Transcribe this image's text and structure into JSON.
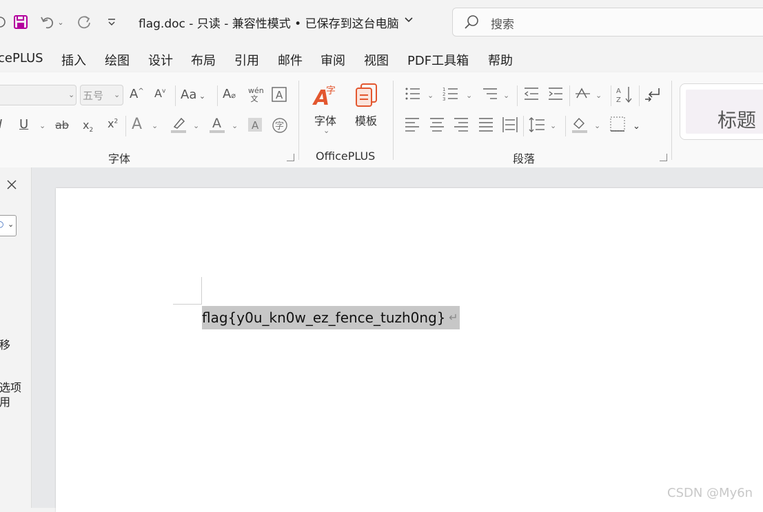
{
  "titlebar": {
    "document_title": "flag.doc  -  只读  -  兼容性模式 • 已保存到这台电脑"
  },
  "search": {
    "placeholder": "搜索"
  },
  "menu": {
    "items": [
      "cePLUS",
      "插入",
      "绘图",
      "设计",
      "布局",
      "引用",
      "邮件",
      "审阅",
      "视图",
      "PDF工具箱",
      "帮助"
    ]
  },
  "ribbon": {
    "font_size_value": "五号",
    "case_label": "Aa",
    "font_group_label": "字体",
    "officeplus": {
      "font_button": "字体",
      "template_button": "模板",
      "group_label": "OfficePLUS"
    },
    "paragraph_group_label": "段落",
    "style_heading": "标题"
  },
  "sidepane": {
    "text_move": "移",
    "text_options1": "选项",
    "text_options2": "用"
  },
  "document": {
    "content": "flag{y0u_kn0w_ez_fence_tuzh0ng}"
  },
  "watermark": "CSDN @My6n",
  "colors": {
    "save_icon": "#b4009e",
    "officeplus_font_icon": "#e3572f",
    "template_icon": "#e3572f",
    "highlight": "#c7c7c7",
    "page_background": "#ffffff",
    "canvas_background": "#e7e8ea"
  }
}
